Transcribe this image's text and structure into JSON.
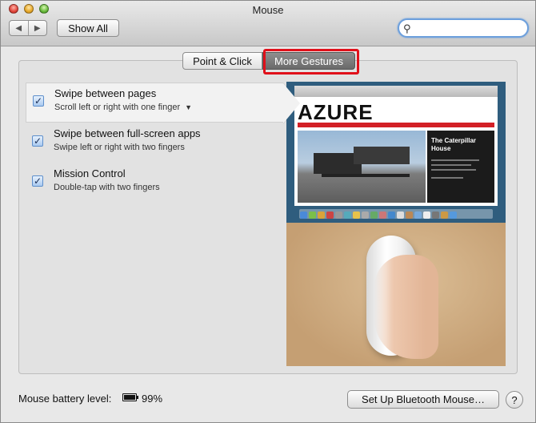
{
  "window": {
    "title": "Mouse"
  },
  "toolbar": {
    "back_glyph": "◀",
    "forward_glyph": "▶",
    "show_all_label": "Show All",
    "search_placeholder": "",
    "search_icon": "magnifier-icon"
  },
  "tabs": [
    {
      "label": "Point & Click",
      "selected": false
    },
    {
      "label": "More Gestures",
      "selected": true
    }
  ],
  "gestures": [
    {
      "title": "Swipe between pages",
      "subtitle": "Scroll left or right with one finger",
      "checked": true,
      "has_dropdown": true
    },
    {
      "title": "Swipe between full-screen apps",
      "subtitle": "Swipe left or right with two fingers",
      "checked": true,
      "has_dropdown": false
    },
    {
      "title": "Mission Control",
      "subtitle": "Double-tap with two fingers",
      "checked": true,
      "has_dropdown": false
    }
  ],
  "preview": {
    "site_logo": "AZURE",
    "article_headline": "The Caterpillar House"
  },
  "footer": {
    "battery_label": "Mouse battery level:",
    "battery_value": "99%",
    "bluetooth_button": "Set Up Bluetooth Mouse…",
    "help_label": "?"
  },
  "colors": {
    "highlight": "#e0101a",
    "selected_tab": "#7a7a7a",
    "checkbox_blue": "#5e8fcb"
  }
}
